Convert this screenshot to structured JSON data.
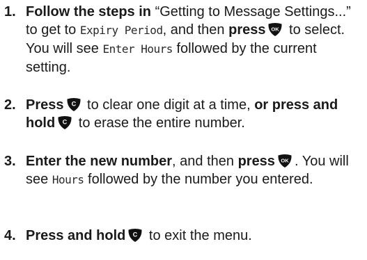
{
  "steps": [
    {
      "number": "1.",
      "parts": {
        "a_bold": "Follow the steps in",
        "b": " “Getting to Message Settings...” to get to ",
        "c_lcd": "Expiry Period",
        "d": ", and then ",
        "e_bold": "press",
        "f": " to select. You will see ",
        "g_lcd": "Enter Hours",
        "h": " followed by the current setting."
      }
    },
    {
      "number": "2.",
      "parts": {
        "a_bold": "Press",
        "b": " to clear one digit at a time, ",
        "c_bold": "or press and hold",
        "d": " to erase the entire number."
      }
    },
    {
      "number": "3.",
      "parts": {
        "a_bold": "Enter the new number",
        "b": ", and then ",
        "c_bold": "press",
        "d": ". You will see ",
        "e_lcd": "Hours",
        "f": " followed by the number you entered."
      }
    },
    {
      "number": "4.",
      "parts": {
        "a_bold": "Press and hold",
        "b": " to exit the menu."
      }
    }
  ],
  "keys": {
    "ok_label": "OK",
    "clear_label": "C",
    "key_color": "#111111",
    "key_text_color": "#ffffff"
  }
}
